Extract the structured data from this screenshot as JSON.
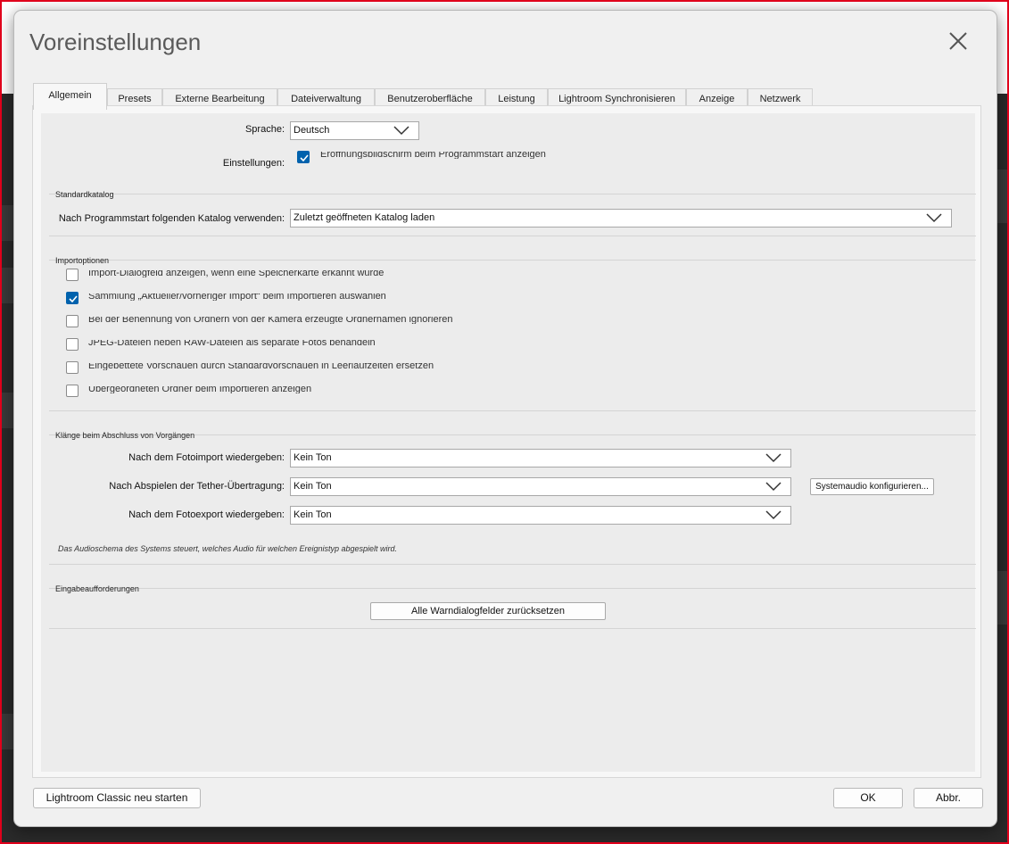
{
  "window": {
    "title": "Voreinstellungen"
  },
  "tabs": [
    {
      "label": "Allgemein",
      "active": true
    },
    {
      "label": "Presets"
    },
    {
      "label": "Externe Bearbeitung"
    },
    {
      "label": "Dateiverwaltung"
    },
    {
      "label": "Benutzeroberfläche"
    },
    {
      "label": "Leistung"
    },
    {
      "label": "Lightroom Synchronisieren"
    },
    {
      "label": "Anzeige"
    },
    {
      "label": "Netzwerk"
    }
  ],
  "general": {
    "language_label": "Sprache:",
    "language_value": "Deutsch",
    "settings_label": "Einstellungen:",
    "splash_checkbox_label": "Eröffnungsbildschirm beim Programmstart anzeigen",
    "splash_checked": true
  },
  "catalog": {
    "group_title": "Standardkatalog",
    "label": "Nach Programmstart folgenden Katalog verwenden:",
    "value": "Zuletzt geöffneten Katalog laden"
  },
  "import": {
    "group_title": "Importoptionen",
    "options": [
      {
        "label": "Import-Dialogfeld anzeigen, wenn eine Speicherkarte erkannt wurde",
        "checked": false
      },
      {
        "label": "Sammlung „Aktueller/vorheriger Import“ beim Importieren auswählen",
        "checked": true
      },
      {
        "label": "Bei der Benennung von Ordnern von der Kamera erzeugte Ordnernamen ignorieren",
        "checked": false
      },
      {
        "label": "JPEG-Dateien neben RAW-Dateien als separate Fotos behandeln",
        "checked": false
      },
      {
        "label": "Eingebettete Vorschauen durch Standardvorschauen in Leerlaufzeiten ersetzen",
        "checked": false
      },
      {
        "label": "Übergeordneten Ordner beim Importieren anzeigen",
        "checked": false
      }
    ]
  },
  "sounds": {
    "group_title": "Klänge beim Abschluss von Vorgängen",
    "rows": [
      {
        "label": "Nach dem Fotoimport wiedergeben:",
        "value": "Kein Ton"
      },
      {
        "label": "Nach Abspielen der Tether-Übertragung:",
        "value": "Kein Ton"
      },
      {
        "label": "Nach dem Fotoexport wiedergeben:",
        "value": "Kein Ton"
      }
    ],
    "configure_button": "Systemaudio konfigurieren...",
    "note": "Das Audioschema des Systems steuert, welches Audio für welchen Ereignistyp abgespielt wird."
  },
  "prompts": {
    "group_title": "Eingabeaufforderungen",
    "reset_button": "Alle Warndialogfelder zurücksetzen"
  },
  "footer": {
    "restart_button": "Lightroom Classic neu starten",
    "ok_button": "OK",
    "cancel_button": "Abbr."
  },
  "colors": {
    "accent": "#0062ad",
    "frame": "#e0001b"
  }
}
